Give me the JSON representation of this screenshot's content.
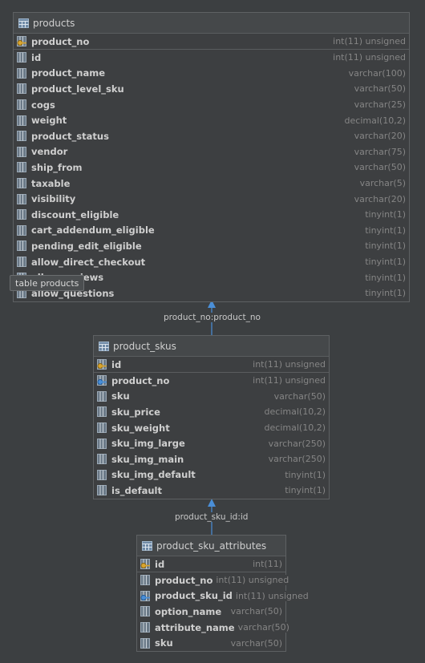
{
  "tables": [
    {
      "name": "products",
      "tooltip": "table products",
      "columns": [
        {
          "name": "product_no",
          "type": "int(11) unsigned",
          "key": "pk"
        },
        {
          "name": "id",
          "type": "int(11) unsigned",
          "key": "none"
        },
        {
          "name": "product_name",
          "type": "varchar(100)",
          "key": "none"
        },
        {
          "name": "product_level_sku",
          "type": "varchar(50)",
          "key": "none"
        },
        {
          "name": "cogs",
          "type": "varchar(25)",
          "key": "none"
        },
        {
          "name": "weight",
          "type": "decimal(10,2)",
          "key": "none"
        },
        {
          "name": "product_status",
          "type": "varchar(20)",
          "key": "none"
        },
        {
          "name": "vendor",
          "type": "varchar(75)",
          "key": "none"
        },
        {
          "name": "ship_from",
          "type": "varchar(50)",
          "key": "none"
        },
        {
          "name": "taxable",
          "type": "varchar(5)",
          "key": "none"
        },
        {
          "name": "visibility",
          "type": "varchar(20)",
          "key": "none"
        },
        {
          "name": "discount_eligible",
          "type": "tinyint(1)",
          "key": "none"
        },
        {
          "name": "cart_addendum_eligible",
          "type": "tinyint(1)",
          "key": "none"
        },
        {
          "name": "pending_edit_eligible",
          "type": "tinyint(1)",
          "key": "none"
        },
        {
          "name": "allow_direct_checkout",
          "type": "tinyint(1)",
          "key": "none"
        },
        {
          "name": "allow_reviews",
          "type": "tinyint(1)",
          "key": "none"
        },
        {
          "name": "allow_questions",
          "type": "tinyint(1)",
          "key": "none"
        }
      ]
    },
    {
      "name": "product_skus",
      "columns": [
        {
          "name": "id",
          "type": "int(11) unsigned",
          "key": "pk"
        },
        {
          "name": "product_no",
          "type": "int(11) unsigned",
          "key": "fk"
        },
        {
          "name": "sku",
          "type": "varchar(50)",
          "key": "none"
        },
        {
          "name": "sku_price",
          "type": "decimal(10,2)",
          "key": "none"
        },
        {
          "name": "sku_weight",
          "type": "decimal(10,2)",
          "key": "none"
        },
        {
          "name": "sku_img_large",
          "type": "varchar(250)",
          "key": "none"
        },
        {
          "name": "sku_img_main",
          "type": "varchar(250)",
          "key": "none"
        },
        {
          "name": "sku_img_default",
          "type": "tinyint(1)",
          "key": "none"
        },
        {
          "name": "is_default",
          "type": "tinyint(1)",
          "key": "none"
        }
      ]
    },
    {
      "name": "product_sku_attributes",
      "columns": [
        {
          "name": "id",
          "type": "int(11)",
          "key": "pk"
        },
        {
          "name": "product_no",
          "type": "int(11) unsigned",
          "key": "none"
        },
        {
          "name": "product_sku_id",
          "type": "int(11) unsigned",
          "key": "fk"
        },
        {
          "name": "option_name",
          "type": "varchar(50)",
          "key": "none"
        },
        {
          "name": "attribute_name",
          "type": "varchar(50)",
          "key": "none"
        },
        {
          "name": "sku",
          "type": "varchar(50)",
          "key": "none"
        }
      ]
    }
  ],
  "relations": [
    {
      "label": "product_no:product_no"
    },
    {
      "label": "product_sku_id:id"
    }
  ],
  "colors": {
    "background": "#3c3f41",
    "connector": "#4a8fd8",
    "key_gold": "#c9a23a",
    "fk_blue": "#4a8fd8"
  }
}
